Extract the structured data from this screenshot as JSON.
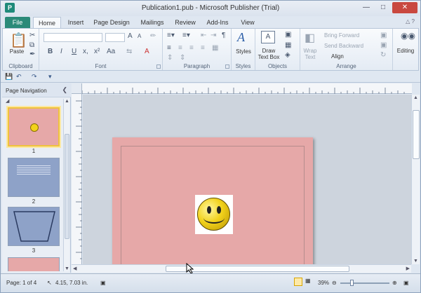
{
  "window": {
    "title": "Publication1.pub - Microsoft Publisher (Trial)",
    "app_icon": "P"
  },
  "tabs": [
    "File",
    "Home",
    "Insert",
    "Page Design",
    "Mailings",
    "Review",
    "Add-Ins",
    "View"
  ],
  "ribbon": {
    "clipboard": {
      "label": "Clipboard",
      "paste": "Paste"
    },
    "font": {
      "label": "Font",
      "bold": "B",
      "italic": "I",
      "underline": "U",
      "subscript": "x,",
      "superscript": "x²",
      "change_case": "Aa",
      "grow": "A",
      "shrink": "A"
    },
    "paragraph": {
      "label": "Paragraph"
    },
    "styles": {
      "label": "Styles",
      "styles_btn": "Styles"
    },
    "objects": {
      "label": "Objects",
      "draw_text_box_line1": "Draw",
      "draw_text_box_line2": "Text Box"
    },
    "arrange": {
      "label": "Arrange",
      "wrap_text_line1": "Wrap",
      "wrap_text_line2": "Text",
      "bring_forward": "Bring Forward",
      "send_backward": "Send Backward",
      "align": "Align"
    },
    "editing": {
      "label": "Editing"
    }
  },
  "nav": {
    "title": "Page Navigation",
    "pages": [
      {
        "number": "1"
      },
      {
        "number": "2"
      },
      {
        "number": "3"
      }
    ]
  },
  "status": {
    "page": "Page: 1 of 4",
    "position": "4.15, 7.03 in.",
    "zoom": "39%",
    "zoom_level_fraction": 0.39
  },
  "colors": {
    "page_fill": "#e6a8a8",
    "slide_blue": "#8ea2c8",
    "file_tab": "#2b8a78"
  }
}
